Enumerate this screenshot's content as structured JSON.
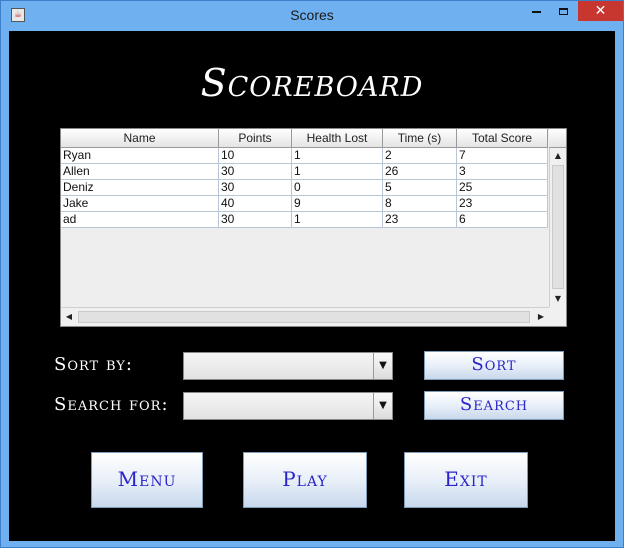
{
  "window": {
    "title": "Scores",
    "close_glyph": "✕"
  },
  "heading": "Scoreboard",
  "table": {
    "columns": [
      "Name",
      "Points",
      "Health Lost",
      "Time (s)",
      "Total Score"
    ],
    "rows": [
      [
        "Ryan",
        "10",
        "1",
        "2",
        "7"
      ],
      [
        "Allen",
        "30",
        "1",
        "26",
        "3"
      ],
      [
        "Deniz",
        "30",
        "0",
        "5",
        "25"
      ],
      [
        "Jake",
        "40",
        "9",
        "8",
        "23"
      ],
      [
        "ad",
        "30",
        "1",
        "23",
        "6"
      ]
    ]
  },
  "controls": {
    "sort_label": "Sort by:",
    "sort_value": "",
    "sort_button": "Sort",
    "search_label": "Search for:",
    "search_value": "",
    "search_button": "Search"
  },
  "nav": {
    "menu": "Menu",
    "play": "Play",
    "exit": "Exit"
  },
  "colors": {
    "titlebar": "#6fb0f0",
    "background": "#000000",
    "button_text": "#2b24c8",
    "close": "#c7372f"
  }
}
